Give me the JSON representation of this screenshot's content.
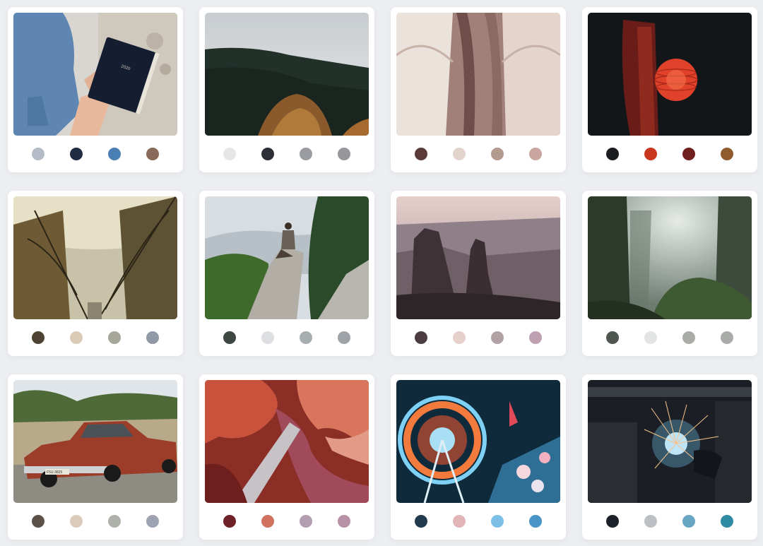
{
  "cards": [
    {
      "subject": "hand-holding-notebook",
      "swatches": [
        "#b5bcc8",
        "#1f2c44",
        "#4a7fb5",
        "#8a6a58"
      ],
      "notebook_text": "2020"
    },
    {
      "subject": "forest-hillside",
      "swatches": [
        "#e6e6e6",
        "#2c2f36",
        "#9a9ca1",
        "#97979b"
      ]
    },
    {
      "subject": "cathedral-arches",
      "swatches": [
        "#5a3b3a",
        "#e2d3cc",
        "#b39a8e",
        "#c9a6a0"
      ]
    },
    {
      "subject": "red-paper-lantern",
      "swatches": [
        "#1b1d20",
        "#c9371f",
        "#6e1f1e",
        "#8f5a2e"
      ]
    },
    {
      "subject": "suspension-bridge",
      "swatches": [
        "#4e4333",
        "#dbcbb6",
        "#a6a799",
        "#8f9aa6"
      ]
    },
    {
      "subject": "person-on-rock",
      "swatches": [
        "#3d4640",
        "#dedfe2",
        "#a7aeaf",
        "#9ea3a8"
      ]
    },
    {
      "subject": "desert-canyon",
      "swatches": [
        "#4a3c40",
        "#e7cfcc",
        "#b0a1a5",
        "#bfa0b1"
      ]
    },
    {
      "subject": "misty-forest-canyon",
      "swatches": [
        "#4f5650",
        "#e3e5e4",
        "#a9aba6",
        "#a8aba8"
      ]
    },
    {
      "subject": "vintage-car",
      "swatches": [
        "#5b5148",
        "#dccbbb",
        "#aeb2ab",
        "#9ea3b3"
      ],
      "plate_text": "F5U-3825"
    },
    {
      "subject": "slot-canyon",
      "swatches": [
        "#6e2228",
        "#d1725e",
        "#b29db1",
        "#b792a6"
      ]
    },
    {
      "subject": "ferris-wheel",
      "swatches": [
        "#213a4e",
        "#e1b5b8",
        "#7cc0e8",
        "#4a95c8"
      ]
    },
    {
      "subject": "welding-sparks",
      "swatches": [
        "#1c2129",
        "#bcc0c4",
        "#69a6c2",
        "#2f8aa3"
      ]
    }
  ]
}
